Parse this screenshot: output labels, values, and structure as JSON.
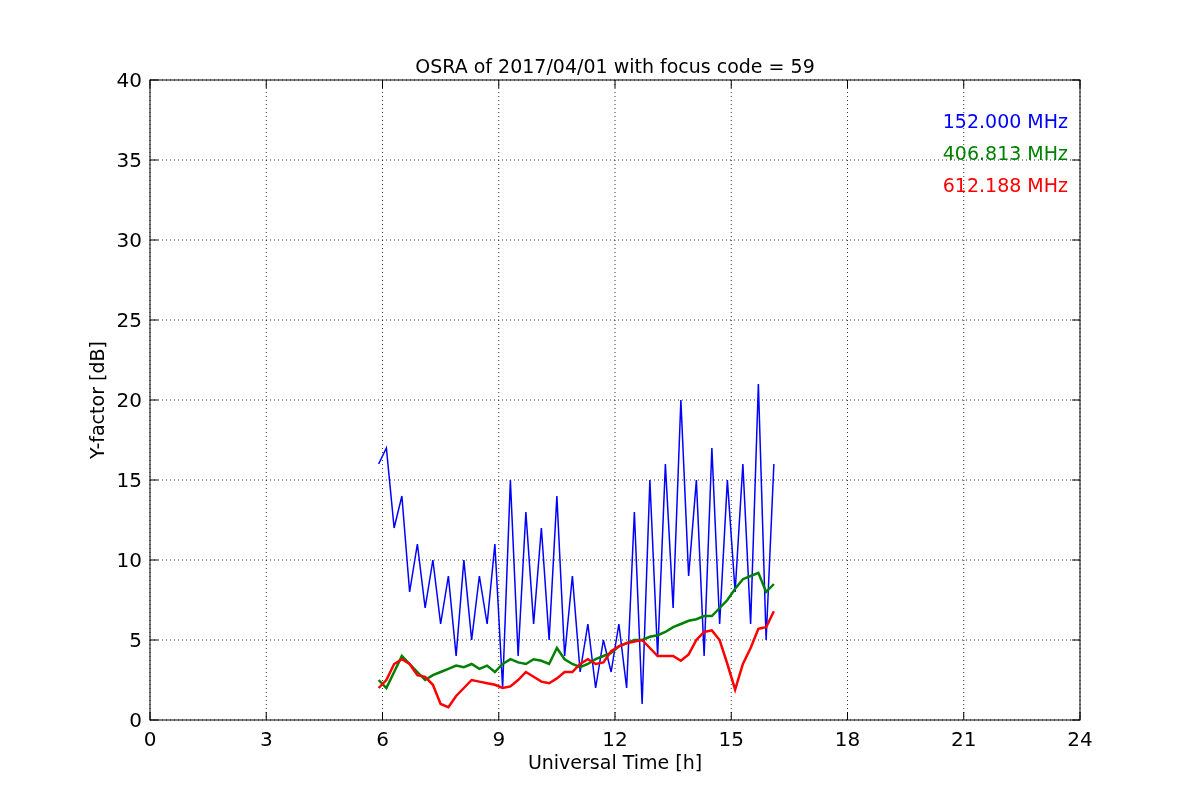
{
  "chart_data": {
    "type": "line",
    "grid": true,
    "title": "OSRA of 2017/04/01 with focus code = 59",
    "xlabel": "Universal Time [h]",
    "ylabel": "Y-factor [dB]",
    "x": [
      5.9,
      6.1,
      6.3,
      6.5,
      6.7,
      6.9,
      7.1,
      7.3,
      7.5,
      7.7,
      7.9,
      8.1,
      8.3,
      8.5,
      8.7,
      8.9,
      9.1,
      9.3,
      9.5,
      9.7,
      9.9,
      10.1,
      10.3,
      10.5,
      10.7,
      10.9,
      11.1,
      11.3,
      11.5,
      11.7,
      11.9,
      12.1,
      12.3,
      12.5,
      12.7,
      12.9,
      13.1,
      13.3,
      13.5,
      13.7,
      13.9,
      14.1,
      14.3,
      14.5,
      14.7,
      14.9,
      15.1,
      15.3,
      15.5,
      15.7,
      15.9,
      16.1
    ],
    "series": [
      {
        "name": "152.000 MHz",
        "color": "#0000ff",
        "values": [
          16,
          17,
          12,
          14,
          8,
          11,
          7,
          10,
          6,
          9,
          4,
          10,
          5,
          9,
          6,
          11,
          2,
          15,
          4,
          13,
          6,
          12,
          5,
          14,
          4,
          9,
          3,
          6,
          2,
          5,
          3,
          6,
          2,
          13,
          1,
          15,
          4,
          16,
          7,
          20,
          9,
          15,
          4,
          17,
          6,
          15,
          8,
          16,
          6,
          21,
          5,
          16
        ]
      },
      {
        "name": "406.813 MHz",
        "color": "#008000",
        "values": [
          2.5,
          2,
          3,
          4,
          3.5,
          3,
          2.5,
          2.8,
          3,
          3.2,
          3.4,
          3.3,
          3.5,
          3.2,
          3.4,
          3,
          3.5,
          3.8,
          3.6,
          3.5,
          3.8,
          3.7,
          3.5,
          4.5,
          3.8,
          3.5,
          3.3,
          3.5,
          3.8,
          4,
          4.2,
          4.6,
          4.8,
          5,
          5,
          5.2,
          5.3,
          5.5,
          5.8,
          6,
          6.2,
          6.3,
          6.5,
          6.5,
          7,
          7.5,
          8.2,
          8.8,
          9,
          9.2,
          8,
          8.5
        ]
      },
      {
        "name": "612.188 MHz",
        "color": "#ff0000",
        "values": [
          2,
          2.5,
          3.5,
          3.8,
          3.5,
          2.8,
          2.7,
          2.2,
          1,
          0.8,
          1.5,
          2,
          2.5,
          2.4,
          2.3,
          2.2,
          2,
          2.1,
          2.5,
          3,
          2.7,
          2.4,
          2.3,
          2.6,
          3,
          3,
          3.5,
          3.8,
          3.5,
          3.6,
          4.3,
          4.6,
          4.8,
          4.9,
          5,
          4.5,
          4,
          4,
          4,
          3.7,
          4.1,
          5,
          5.5,
          5.6,
          5,
          3.5,
          1.9,
          3.5,
          4.5,
          5.7,
          5.8,
          6.8
        ]
      }
    ],
    "xlim": [
      0,
      24
    ],
    "ylim": [
      0,
      40
    ],
    "xticks": [
      0,
      3,
      6,
      9,
      12,
      15,
      18,
      21,
      24
    ],
    "yticks": [
      0,
      5,
      10,
      15,
      20,
      25,
      30,
      35,
      40
    ]
  }
}
